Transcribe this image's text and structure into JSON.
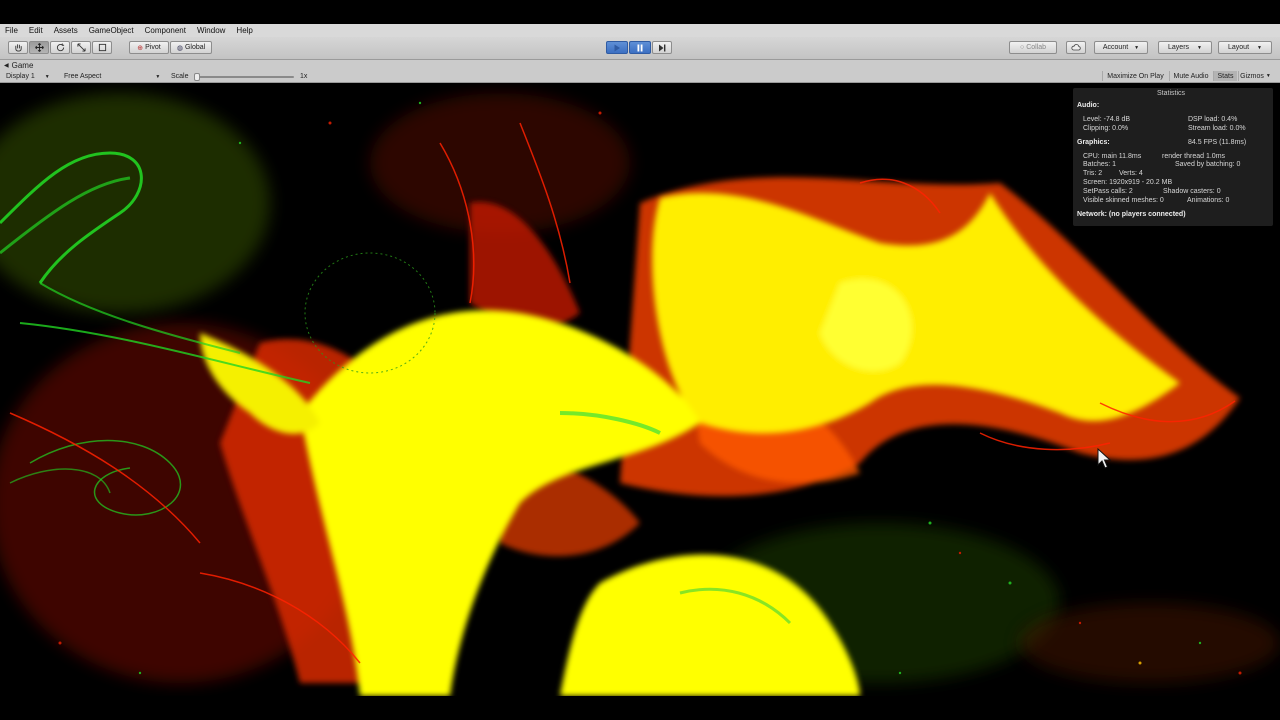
{
  "menu": [
    "File",
    "Edit",
    "Assets",
    "GameObject",
    "Component",
    "Window",
    "Help"
  ],
  "toolbar": {
    "pivot_label": "Pivot",
    "global_label": "Global",
    "collab_label": "Collab",
    "account_label": "Account",
    "layers_label": "Layers",
    "layout_label": "Layout"
  },
  "game": {
    "tab_label": "Game",
    "display_label": "Display 1",
    "aspect_label": "Free Aspect",
    "scale_label": "Scale",
    "scale_value": "1x",
    "maximize_label": "Maximize On Play",
    "mute_label": "Mute Audio",
    "stats_label": "Stats",
    "gizmos_label": "Gizmos"
  },
  "stats": {
    "title": "Statistics",
    "audio_header": "Audio:",
    "level": "Level: -74.8 dB",
    "clipping": "Clipping: 0.0%",
    "dsp_load": "DSP load: 0.4%",
    "stream_load": "Stream load: 0.0%",
    "graphics_header": "Graphics:",
    "fps": "84.5 FPS (11.8ms)",
    "cpu": "CPU: main 11.8ms",
    "render_thread": "render thread 1.0ms",
    "batches": "Batches: 1",
    "saved_batching": "Saved by batching: 0",
    "tris": "Tris: 2",
    "verts": "Verts: 4",
    "screen": "Screen: 1920x919 - 20.2 MB",
    "setpass": "SetPass calls: 2",
    "shadow_casters": "Shadow casters: 0",
    "skinned": "Visible skinned meshes: 0",
    "animations": "Animations: 0",
    "network": "Network: (no players connected)"
  },
  "colors": {
    "particle_yellow": "#ffff00",
    "particle_orange": "#ff7a00",
    "particle_red": "#e01800",
    "particle_green": "#19d319",
    "play_blue": "#3b6fc2"
  },
  "icons": [
    "hand-icon",
    "move-icon",
    "rotate-icon",
    "scale-icon",
    "rect-tool-icon",
    "play-icon",
    "pause-icon",
    "step-icon",
    "cloud-icon",
    "mouse-cursor-icon"
  ]
}
